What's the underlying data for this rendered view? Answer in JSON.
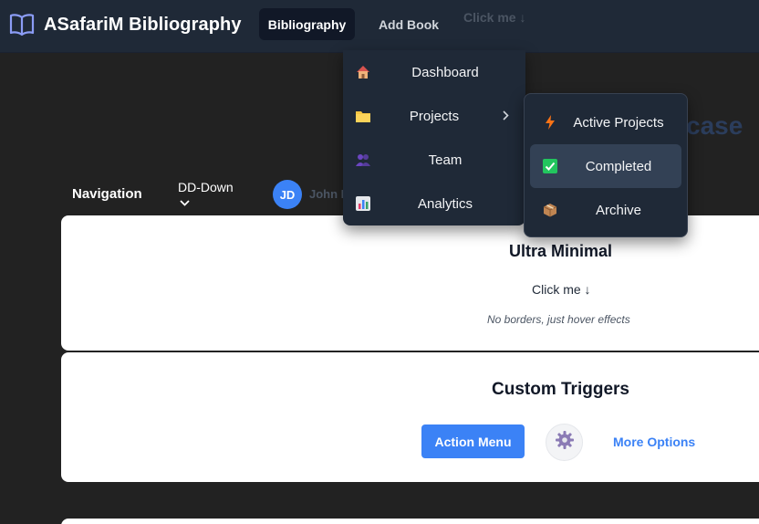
{
  "navbar": {
    "brand_icon": "open-book-icon",
    "brand_title": "ASafariM Bibliography",
    "items": [
      {
        "label": "Bibliography",
        "active": true
      },
      {
        "label": "Add Book",
        "active": false
      }
    ],
    "ghost_trigger": "Click me ↓"
  },
  "nav_row": {
    "label": "Navigation",
    "dropdown_label": "DD-Down",
    "dropdown_chevron": "chevron-down-icon",
    "avatar_initials": "JD",
    "user_name": "John Doe"
  },
  "background_text": "case",
  "dropdown_menu": {
    "items": [
      {
        "label": "Dashboard",
        "icon": "house-icon"
      },
      {
        "label": "Projects",
        "icon": "folder-icon",
        "has_submenu": true
      },
      {
        "label": "Team",
        "icon": "people-icon"
      },
      {
        "label": "Analytics",
        "icon": "bar-chart-icon"
      }
    ]
  },
  "submenu": {
    "items": [
      {
        "label": "Active Projects",
        "icon": "lightning-icon"
      },
      {
        "label": "Completed",
        "icon": "check-box-icon",
        "hovered": true
      },
      {
        "label": "Archive",
        "icon": "package-icon"
      }
    ]
  },
  "cards": {
    "ultra_minimal": {
      "title": "Ultra Minimal",
      "trigger": "Click me ↓",
      "hint": "No borders, just hover effects"
    },
    "custom_triggers": {
      "title": "Custom Triggers",
      "action_button": "Action Menu",
      "gear_icon": "gear-icon",
      "more_link": "More Options"
    }
  },
  "colors": {
    "page_bg": "#222222",
    "navbar_bg": "#1f2937",
    "menu_bg": "#1f2937",
    "accent": "#3b82f6",
    "card_bg": "#ffffff"
  }
}
